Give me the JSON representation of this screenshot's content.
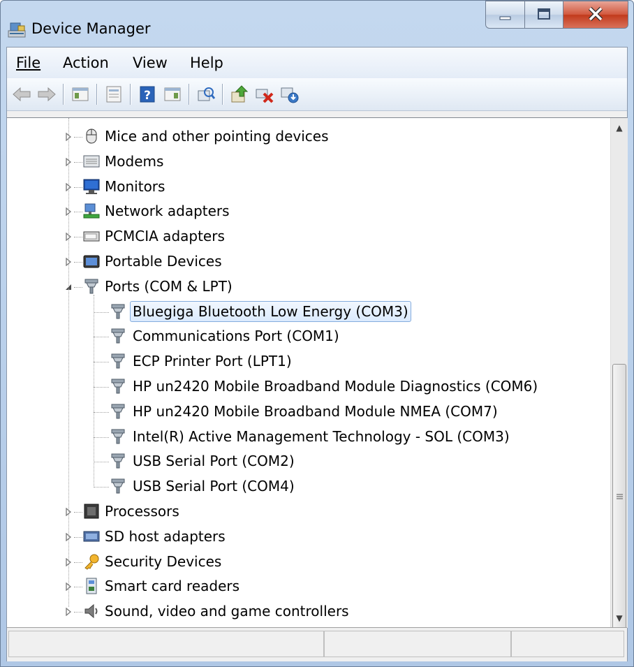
{
  "window": {
    "title": "Device Manager"
  },
  "menu": [
    {
      "label": "File",
      "name": "file"
    },
    {
      "label": "Action",
      "name": "action"
    },
    {
      "label": "View",
      "name": "view"
    },
    {
      "label": "Help",
      "name": "help"
    }
  ],
  "toolbar": [
    "back-icon",
    "forward-icon",
    "show-hide-console-tree-icon",
    "properties-icon",
    "help-icon",
    "show-action-pane-icon",
    "scan-hardware-icon",
    "update-driver-icon",
    "uninstall-icon",
    "disable-device-icon"
  ],
  "tree": {
    "categories_top": [
      {
        "label": "Mice and other pointing devices",
        "icon": "mouse-icon"
      },
      {
        "label": "Modems",
        "icon": "modem-icon"
      },
      {
        "label": "Monitors",
        "icon": "monitor-icon"
      },
      {
        "label": "Network adapters",
        "icon": "network-adapter-icon"
      },
      {
        "label": "PCMCIA adapters",
        "icon": "pcmcia-icon"
      },
      {
        "label": "Portable Devices",
        "icon": "portable-device-icon"
      }
    ],
    "ports": {
      "label": "Ports (COM & LPT)",
      "children": [
        {
          "label": "Bluegiga Bluetooth Low Energy (COM3)",
          "selected": true
        },
        {
          "label": "Communications Port (COM1)"
        },
        {
          "label": "ECP Printer Port (LPT1)"
        },
        {
          "label": "HP un2420 Mobile Broadband Module Diagnostics (COM6)"
        },
        {
          "label": "HP un2420 Mobile Broadband Module NMEA (COM7)"
        },
        {
          "label": "Intel(R) Active Management Technology - SOL (COM3)"
        },
        {
          "label": "USB Serial Port (COM2)"
        },
        {
          "label": "USB Serial Port (COM4)"
        }
      ]
    },
    "categories_bottom": [
      {
        "label": "Processors",
        "icon": "processor-icon"
      },
      {
        "label": "SD host adapters",
        "icon": "sd-host-icon"
      },
      {
        "label": "Security Devices",
        "icon": "security-key-icon"
      },
      {
        "label": "Smart card readers",
        "icon": "smart-card-icon"
      },
      {
        "label": "Sound, video and game controllers",
        "icon": "speaker-icon"
      }
    ]
  },
  "colors": {
    "selection_border": "#84acdd",
    "close_button": "#c13a1c"
  }
}
